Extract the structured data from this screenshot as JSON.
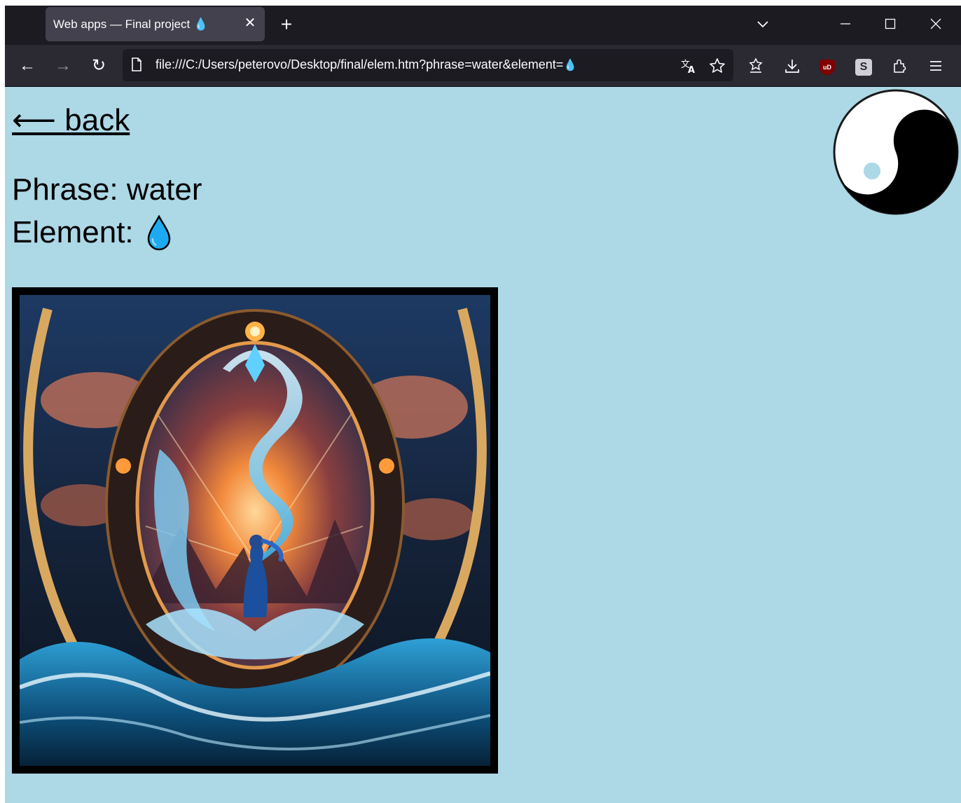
{
  "browser": {
    "tab_title": "Web apps — Final project",
    "tab_emoji": "💧",
    "tab_close": "✕",
    "new_tab": "+",
    "list_all_tabs": "⌄",
    "minimize": "—",
    "maximize": "☐",
    "close": "✕",
    "back": "←",
    "forward": "→",
    "reload": "↻",
    "url": "file:///C:/Users/peterovo/Desktop/final/elem.htm?phrase=water&element=",
    "url_emoji": "💧",
    "icons": {
      "translate": "translate-icon",
      "bookmark": "star-icon",
      "pocket": "save-to-pocket-icon",
      "downloads": "download-icon",
      "ublock": "ublock-origin-icon",
      "s_extension": "s-extension-icon",
      "extensions": "puzzle-icon",
      "menu": "hamburger-menu-icon"
    },
    "ublock_label": "uD",
    "s_label": "S"
  },
  "page": {
    "back_link": "⟵ back",
    "phrase_label": "Phrase: ",
    "phrase_value": "water",
    "element_label": "Element:",
    "element_icon": "water-drop-icon",
    "logo_icon": "yin-yang-icon",
    "image_icon": "water-elemental-artwork",
    "background_color": "#add8e6"
  }
}
